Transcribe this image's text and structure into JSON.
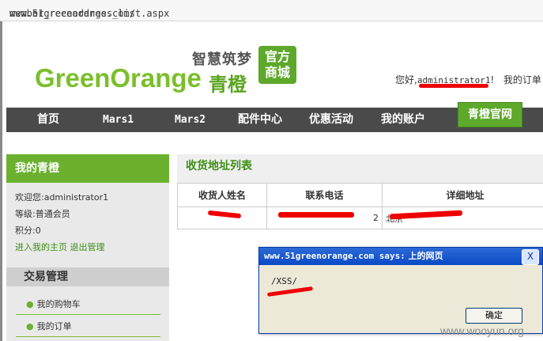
{
  "browser": {
    "url_domain": "www.51greenorange.com/",
    "url_path": "member_receaddress_list.aspx"
  },
  "header": {
    "slogan": "智慧筑梦",
    "brand": "GreenOrange",
    "brand_cn": "青橙",
    "badge_line1": "官方",
    "badge_line2": "商城",
    "greeting_prefix": "您好,",
    "greeting_user": "administrator1",
    "greeting_suffix": "!",
    "my_orders": "我的订单"
  },
  "nav": {
    "items": [
      "首页",
      "Mars1",
      "Mars2",
      "配件中心",
      "优惠活动",
      "我的账户"
    ],
    "tab": "青橙官网"
  },
  "sidebar": {
    "title": "我的青橙",
    "welcome": "欢迎您:administrator1",
    "level": "等级:普通会员",
    "points": "积分:0",
    "link_home": "进入我的主页",
    "link_logout": "退出管理",
    "section": "交易管理",
    "menu": [
      "我的购物车",
      "我的订单"
    ]
  },
  "main": {
    "title": "收货地址列表",
    "columns": [
      "收货人姓名",
      "联系电话",
      "详细地址"
    ],
    "row": {
      "name": "",
      "phone": "2",
      "address": "北京"
    }
  },
  "dialog": {
    "title_mono": "www.51greenorange.com says:",
    "title_cn": " 上的网页",
    "close": "X",
    "message": "/XSS/",
    "ok": "确定"
  },
  "watermark": "www.wooyun.org"
}
